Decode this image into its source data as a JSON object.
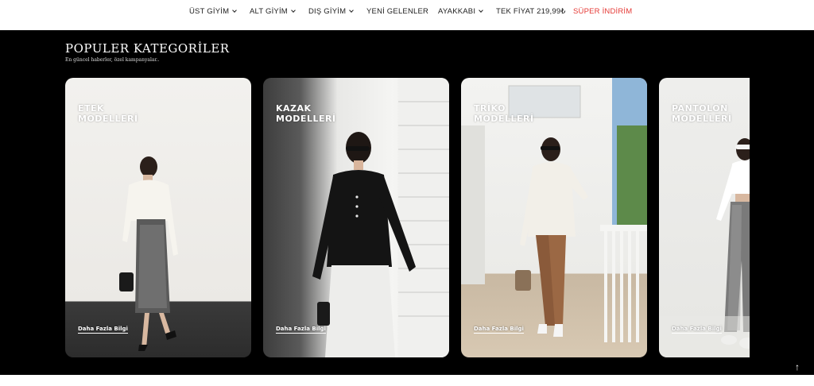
{
  "nav": {
    "items": [
      {
        "label": "ÜST GİYİM",
        "dropdown": true
      },
      {
        "label": "ALT GİYİM",
        "dropdown": true
      },
      {
        "label": "DIŞ GİYİM",
        "dropdown": true
      },
      {
        "label": "YENİ GELENLER",
        "dropdown": false
      },
      {
        "label": "AYAKKABI",
        "dropdown": true
      },
      {
        "label": "TEK FİYAT 219,99₺",
        "dropdown": false
      },
      {
        "label": "SÜPER İNDİRİM",
        "dropdown": false,
        "color": "#e53935"
      }
    ]
  },
  "section": {
    "title": "POPULER KATEGORİLER",
    "subtitle": "En güncel haberler, özel kampanyalar.."
  },
  "cards": [
    {
      "label": "ETEK\nMODELLERİ",
      "link": "Daha Fazla Bilgi"
    },
    {
      "label": "KAZAK\nMODELLERİ",
      "link": "Daha Fazla Bilgi"
    },
    {
      "label": "TRİKO\nMODELLERİ",
      "link": "Daha Fazla Bilgi"
    },
    {
      "label": "PANTOLON\nMODELLERİ",
      "link": "Daha Fazla Bilgi"
    }
  ],
  "back_to_top": "↑"
}
